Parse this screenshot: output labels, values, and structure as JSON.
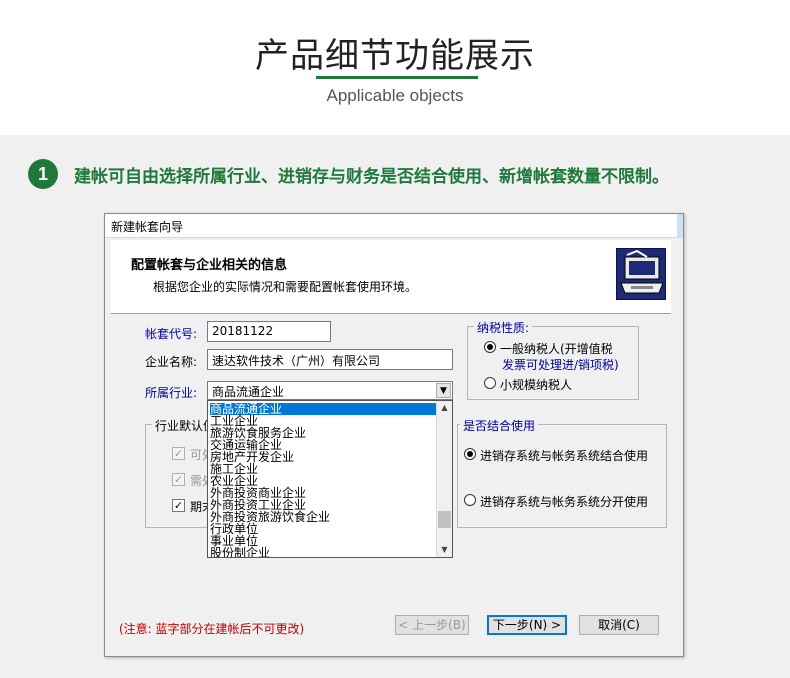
{
  "page": {
    "title": "产品细节功能展示",
    "subtitle": "Applicable objects"
  },
  "feature": {
    "number": "1",
    "text": "建帐可自由选择所属行业、进销存与财务是否结合使用、新增帐套数量不限制。"
  },
  "dialog": {
    "title": "新建帐套向导",
    "header": "配置帐套与企业相关的信息",
    "subheader": "根据您企业的实际情况和需要配置帐套使用环境。",
    "logo_icon": "wizard-computer-icon",
    "account_code_label": "帐套代号:",
    "account_code_value": "20181122",
    "company_name_label": "企业名称:",
    "company_name_value": "速达软件技术（广州）有限公司",
    "industry_label": "所属行业:",
    "industry_value": "商品流通企业",
    "industry_options": [
      "商品流通企业",
      "工业企业",
      "旅游饮食服务企业",
      "交通运输企业",
      "房地产开发企业",
      "施工企业",
      "农业企业",
      "外商投资商业企业",
      "外商投资工业企业",
      "外商投资旅游饮食企业",
      "行政单位",
      "事业单位",
      "股份制企业"
    ],
    "tax_group_title": "纳税性质:",
    "tax_general": "一般纳税人(开增值税",
    "tax_general_line2": "发票可处理进/销项税)",
    "tax_small": "小规模纳税人",
    "industry_default_group_title": "行业默认值",
    "default_check1": "可处",
    "default_check2": "需处",
    "default_check3": "期末",
    "combine_group_title": "是否结合使用",
    "combine_yes": "进销存系统与帐务系统结合使用",
    "combine_no": "进销存系统与帐务系统分开使用",
    "note": "(注意: 蓝字部分在建帐后不可更改)",
    "btn_prev": "< 上一步(B)",
    "btn_next": "下一步(N) >",
    "btn_cancel": "取消(C)"
  },
  "colors": {
    "accent_green": "#1f7a3a",
    "selection_blue": "#0078d7",
    "note_red": "#c00000",
    "label_blue": "#0000a0"
  }
}
